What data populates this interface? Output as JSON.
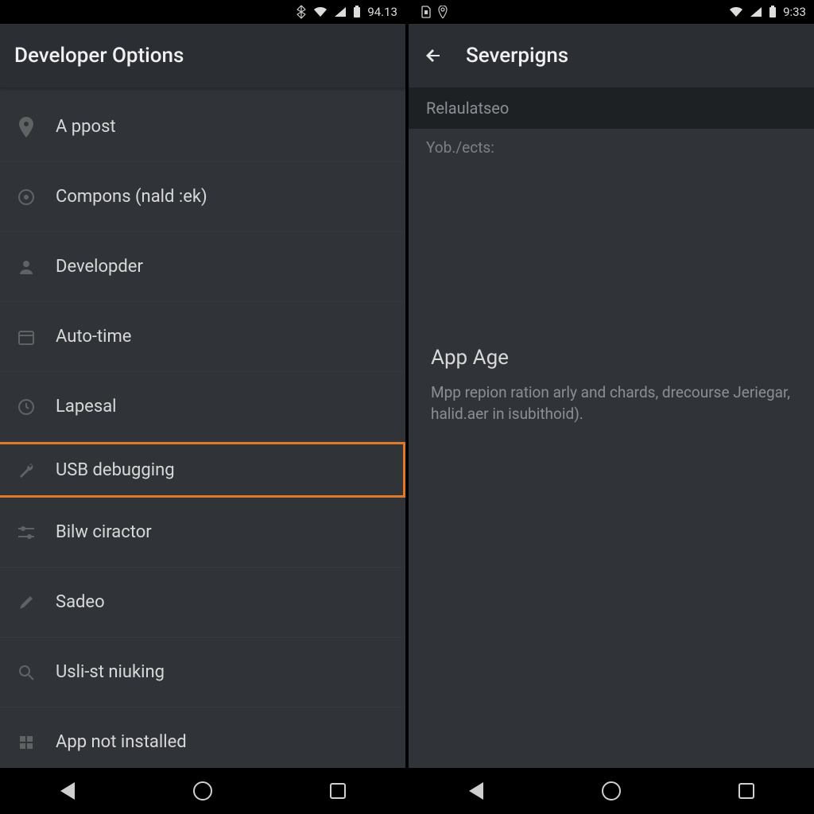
{
  "left": {
    "status": {
      "time": "94.13"
    },
    "header": {
      "title": "Developer Options"
    },
    "items": [
      {
        "label": "A ppost"
      },
      {
        "label": "Compons (nald :ek)"
      },
      {
        "label": "Developder"
      },
      {
        "label": "Auto-time"
      },
      {
        "label": "Lapesal"
      },
      {
        "label": "USB debugging",
        "highlighted": true
      },
      {
        "label": "Bilw ciractor"
      },
      {
        "label": "Sadeo"
      },
      {
        "label": "Usli-st niuking"
      },
      {
        "label": "App not installed"
      }
    ]
  },
  "right": {
    "status": {
      "time": "9:33"
    },
    "header": {
      "title": "Severpigns"
    },
    "section_header": "Relaulatseo",
    "section_sub": "Yob./ects:",
    "content": {
      "title": "App Age",
      "desc": "Mpp repion ration arly and chards, drecourse Jeriegar, halid.aer in isubithoid)."
    }
  }
}
